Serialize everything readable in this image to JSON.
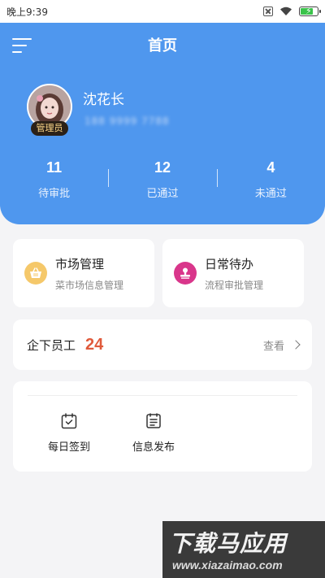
{
  "status_bar": {
    "time": "晚上9:39",
    "battery_level": 0.7
  },
  "header": {
    "title": "首页",
    "user": {
      "name": "沈花长",
      "role": "管理员",
      "phone": "188 9999 7788"
    },
    "stats": [
      {
        "value": "11",
        "label": "待审批"
      },
      {
        "value": "12",
        "label": "已通过"
      },
      {
        "value": "4",
        "label": "未通过"
      }
    ]
  },
  "quick_cards": [
    {
      "title": "市场管理",
      "subtitle": "菜市场信息管理",
      "icon": "basket-icon",
      "color": "#f5c86a"
    },
    {
      "title": "日常待办",
      "subtitle": "流程审批管理",
      "icon": "stamp-icon",
      "color": "#d9368b"
    }
  ],
  "staff": {
    "label": "企下员工",
    "count": "24",
    "view_label": "查看"
  },
  "tools": [
    {
      "label": "每日签到",
      "icon": "calendar-check-icon"
    },
    {
      "label": "信息发布",
      "icon": "document-icon"
    }
  ],
  "watermark": {
    "title": "下载马应用",
    "url": "www.xiazaimao.com"
  },
  "colors": {
    "primary": "#4f97ee",
    "accent_count": "#e05a3b",
    "background": "#f4f4f6"
  }
}
